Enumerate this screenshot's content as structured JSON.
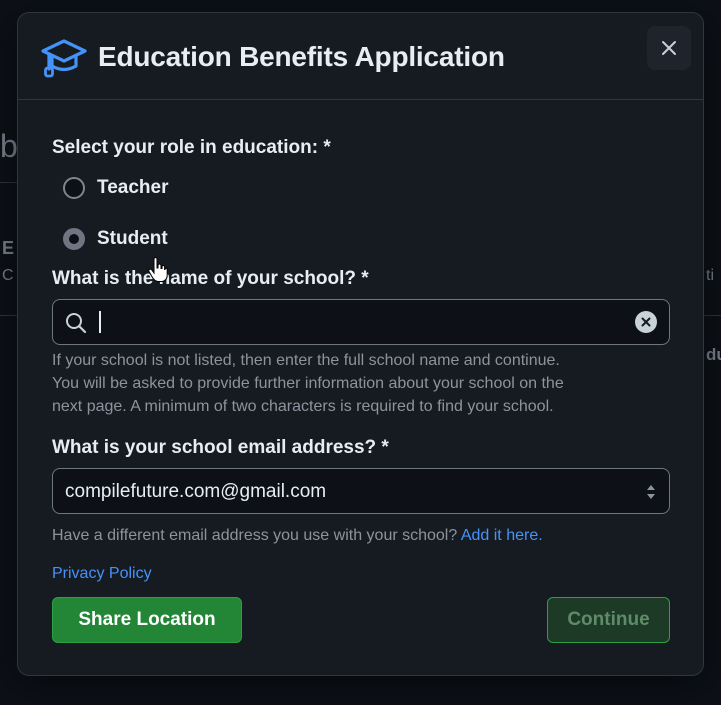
{
  "background": {
    "fragments": [
      "b",
      "E",
      "C",
      "ti",
      "du"
    ]
  },
  "dialog": {
    "title": "Education Benefits Application",
    "header_icon": "graduation-cap-icon",
    "close_icon": "close-icon"
  },
  "role": {
    "label": "Select your role in education: *",
    "options": [
      "Teacher",
      "Student"
    ],
    "selected": "Student"
  },
  "school": {
    "label": "What is the name of your school? *",
    "value": "",
    "help": [
      "If your school is not listed, then enter the full school name and continue.",
      "You will be asked to provide further information about your school on the",
      "next page. A minimum of two characters is required to find your school."
    ]
  },
  "email": {
    "label": "What is your school email address? *",
    "value": "compilefuture.com@gmail.com",
    "help_text": "Have a different email address you use with your school?",
    "help_link": "Add it here."
  },
  "privacy_link": "Privacy Policy",
  "buttons": {
    "share_location": "Share Location",
    "continue": "Continue"
  },
  "colors": {
    "accent": "#4493f8",
    "primary_button": "#238636",
    "dialog_bg": "#161b22"
  }
}
